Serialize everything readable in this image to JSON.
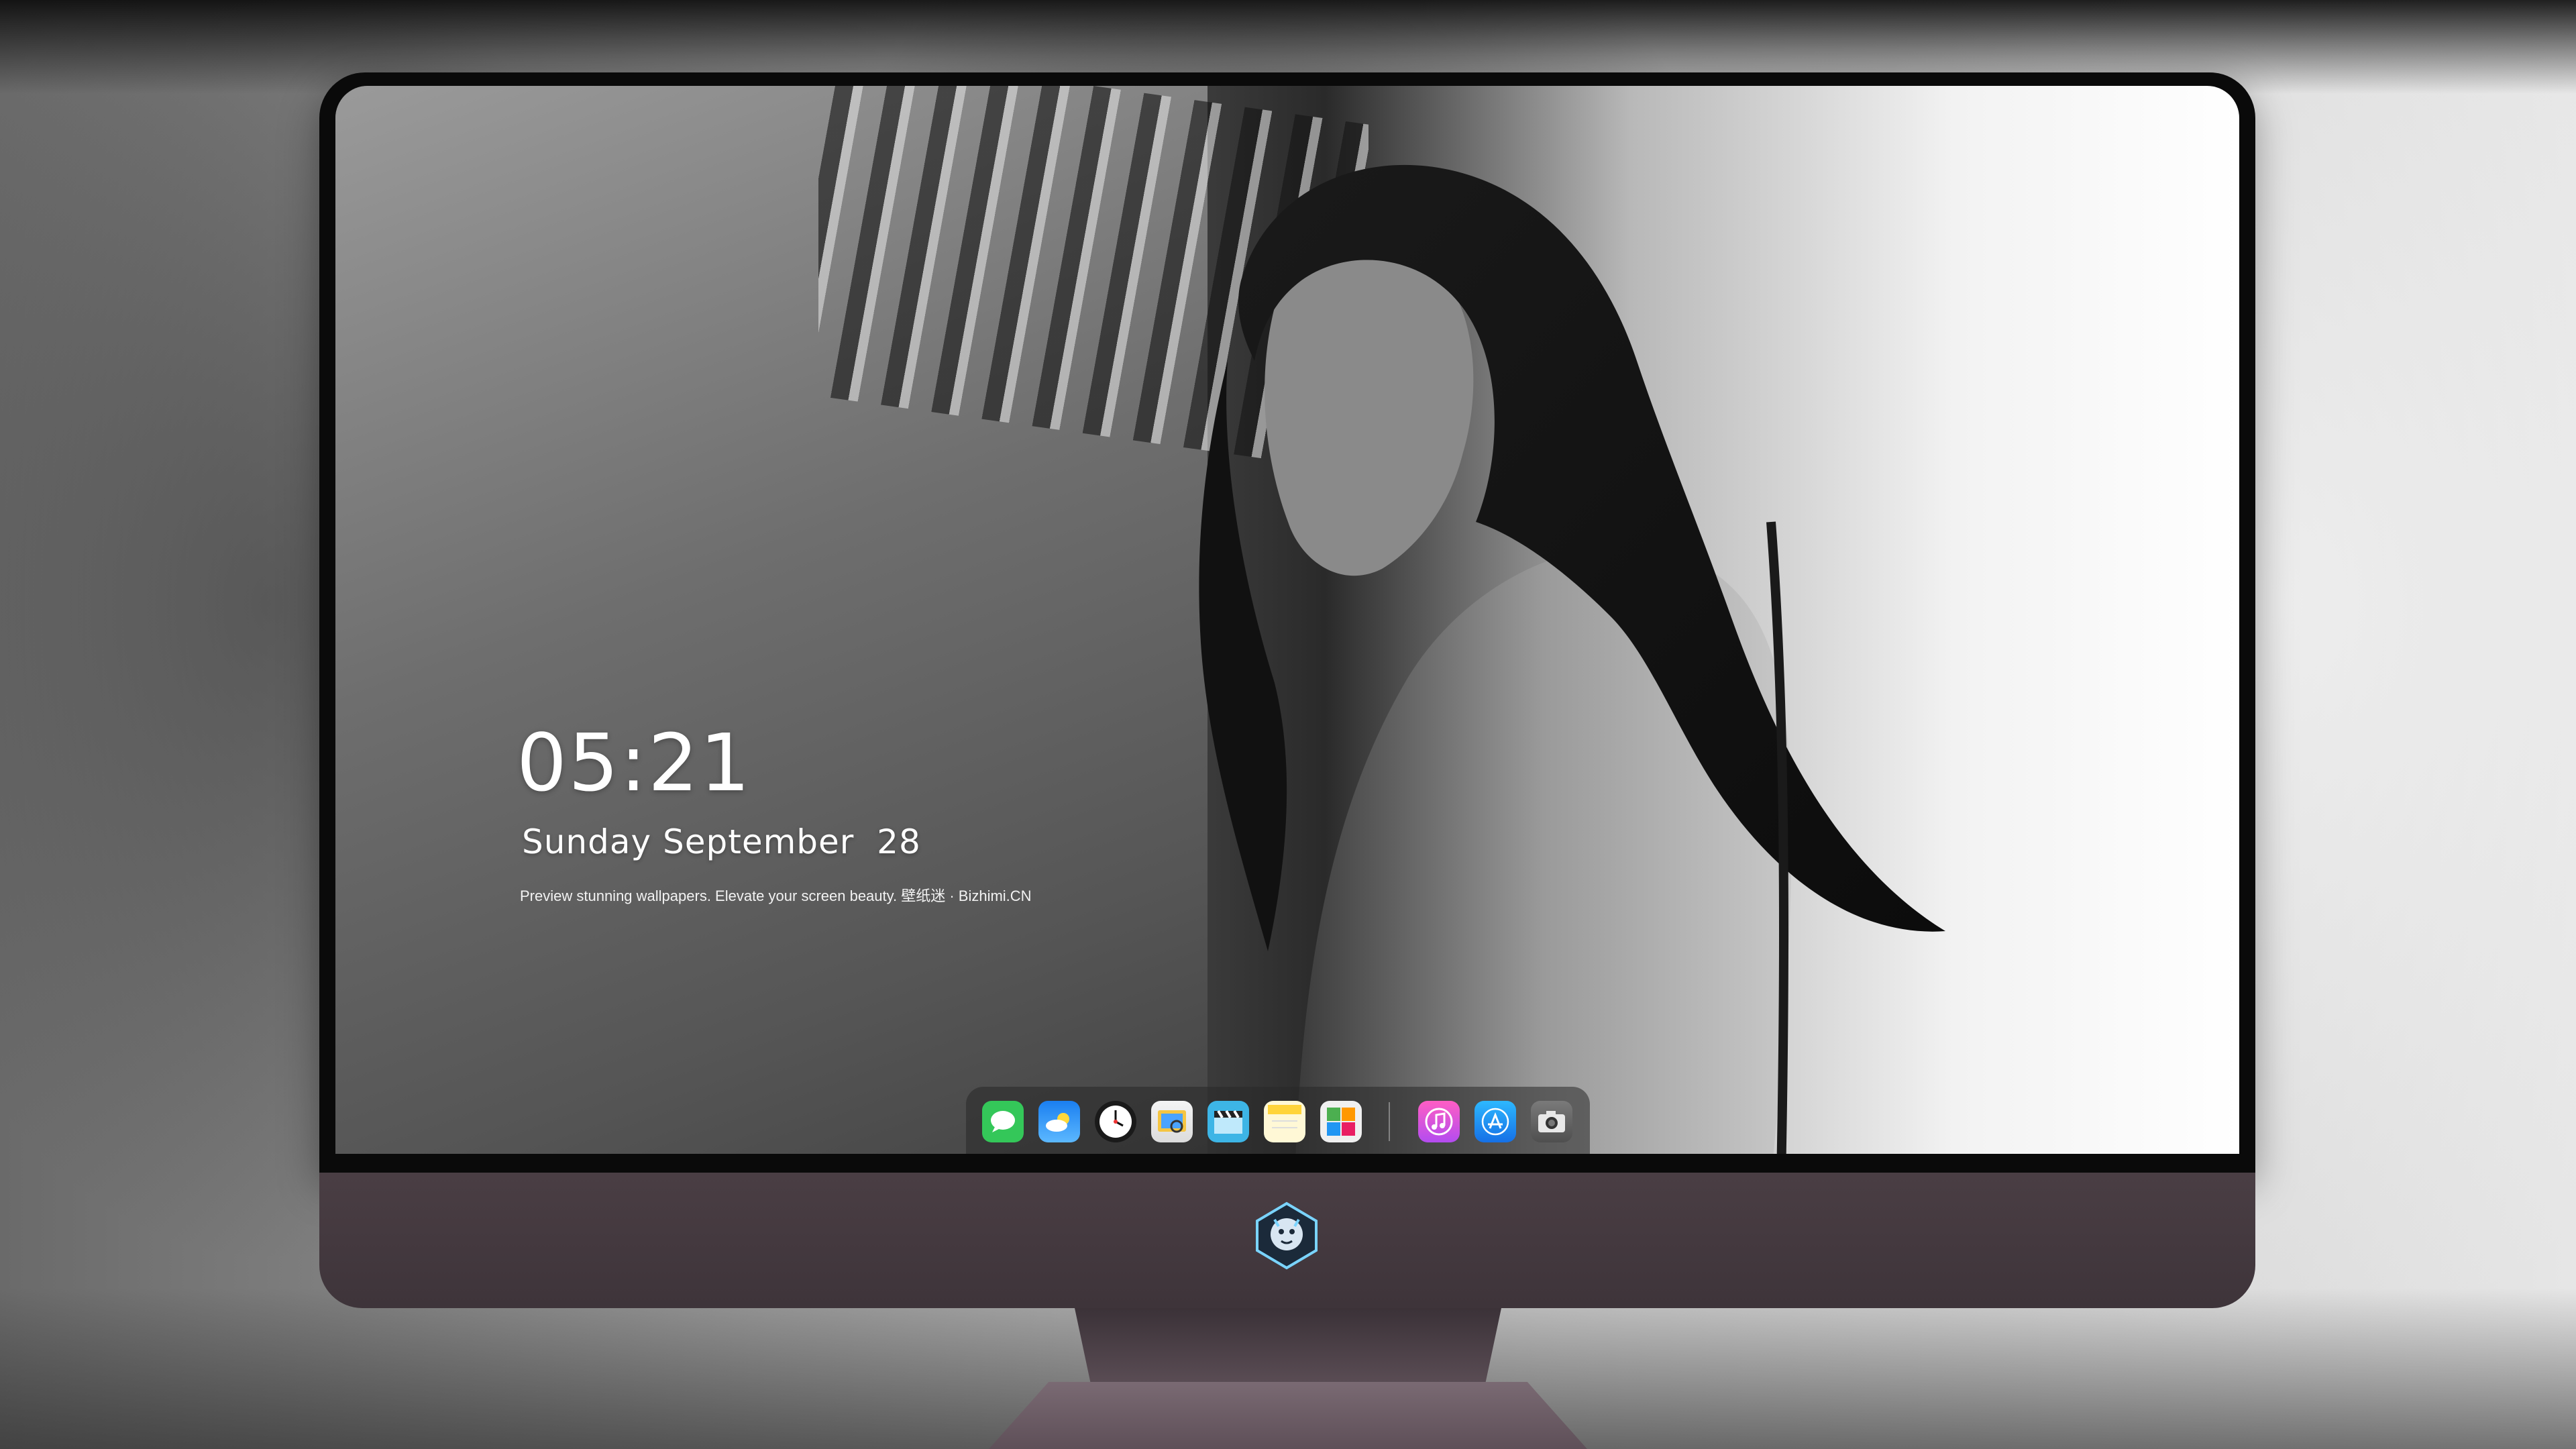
{
  "lockscreen": {
    "time": "05:21",
    "date": "Sunday September  28",
    "tagline": "Preview stunning wallpapers. Elevate your screen beauty. 壁纸迷 · Bizhimi.CN"
  },
  "dock": {
    "apps": [
      {
        "name": "messages-icon",
        "color": "#34c759"
      },
      {
        "name": "weather-icon",
        "color": "#2f8bf5"
      },
      {
        "name": "clock-icon",
        "color": "#1a1a1a"
      },
      {
        "name": "preview-icon",
        "color": "#f5c542"
      },
      {
        "name": "clips-icon",
        "color": "#3db5e6"
      },
      {
        "name": "notes-icon",
        "color": "#ffd43b"
      },
      {
        "name": "photos-icon",
        "color": "#8bc34a"
      },
      {
        "name": "itunes-icon",
        "color": "#d94bd6"
      },
      {
        "name": "app-store-icon",
        "color": "#1f8ef1"
      },
      {
        "name": "camera-icon",
        "color": "#6b6b6b"
      }
    ]
  },
  "colors": {
    "bezel": "#0a0a0a",
    "chin": "#4a3e44",
    "stand": "#5c4e56"
  }
}
